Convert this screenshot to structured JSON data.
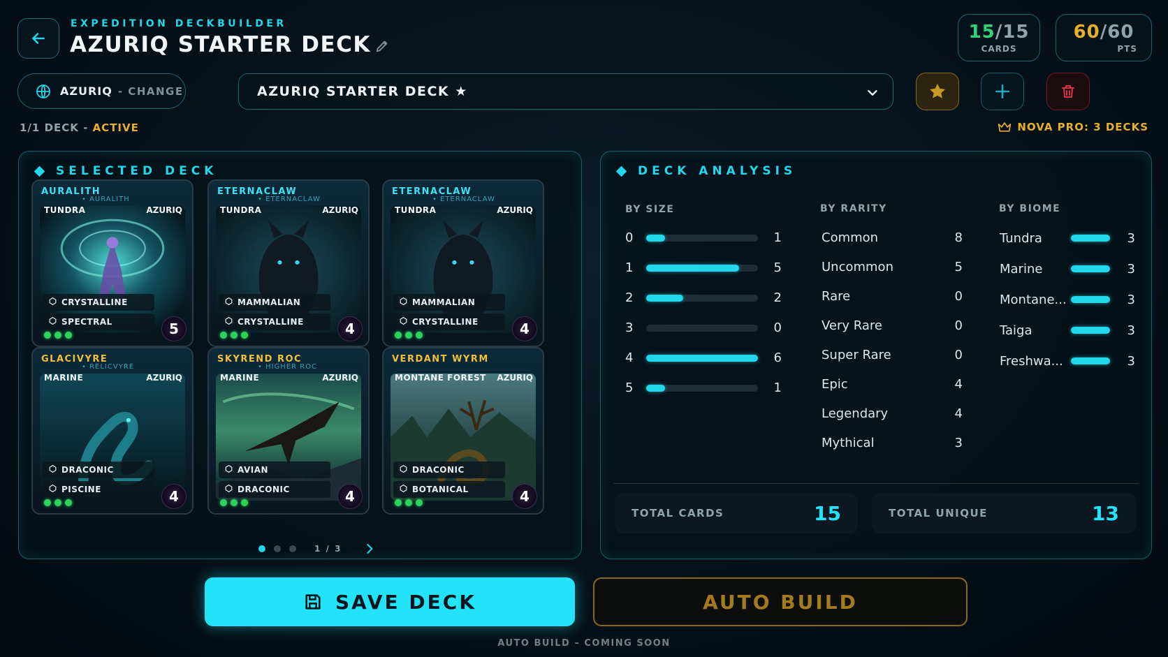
{
  "header": {
    "eyebrow": "EXPEDITION DECKBUILDER",
    "title": "AZURIQ STARTER DECK",
    "cards_count": "15",
    "cards_total": "15",
    "cards_label": "CARDS",
    "pts_count": "60",
    "pts_total": "60",
    "pts_label": "PTS"
  },
  "faction": {
    "name": "AZURIQ",
    "change": "- CHANGE"
  },
  "deck_select": {
    "value": "AZURIQ STARTER DECK ★"
  },
  "deck_status": {
    "count": "1/1 DECK",
    "sep": " - ",
    "state": "ACTIVE"
  },
  "nova_pro": "NOVA PRO: 3 DECKS",
  "selected_deck": {
    "title": "SELECTED DECK",
    "cards": [
      {
        "name": "AURALITH",
        "sub": "• AURALITH",
        "biome": "TUNDRA",
        "faction": "AZURIQ",
        "traits": [
          "CRYSTALLINE",
          "SPECTRAL"
        ],
        "cost": "5",
        "gold": false,
        "art": "aurora"
      },
      {
        "name": "ETERNACLAW",
        "sub": "• ETERNACLAW",
        "biome": "TUNDRA",
        "faction": "AZURIQ",
        "traits": [
          "MAMMALIAN",
          "CRYSTALLINE"
        ],
        "cost": "4",
        "gold": false,
        "art": "wolf"
      },
      {
        "name": "ETERNACLAW",
        "sub": "• ETERNACLAW",
        "biome": "TUNDRA",
        "faction": "AZURIQ",
        "traits": [
          "MAMMALIAN",
          "CRYSTALLINE"
        ],
        "cost": "4",
        "gold": false,
        "art": "wolf"
      },
      {
        "name": "GLACIVYRE",
        "sub": "• RELICVYRE",
        "biome": "MARINE",
        "faction": "AZURIQ",
        "traits": [
          "DRACONIC",
          "PISCINE"
        ],
        "cost": "4",
        "gold": true,
        "art": "sea"
      },
      {
        "name": "SKYREND ROC",
        "sub": "• HIGHER ROC",
        "biome": "MARINE",
        "faction": "AZURIQ",
        "traits": [
          "AVIAN",
          "DRACONIC"
        ],
        "cost": "4",
        "gold": true,
        "art": "bird"
      },
      {
        "name": "VERDANT WYRM",
        "sub": "",
        "biome": "MONTANE FOREST",
        "faction": "AZURIQ",
        "traits": [
          "DRACONIC",
          "BOTANICAL"
        ],
        "cost": "4",
        "gold": true,
        "art": "forest"
      }
    ],
    "page": "1 / 3"
  },
  "analysis": {
    "title": "DECK ANALYSIS",
    "by_size": {
      "label": "BY SIZE",
      "rows": [
        {
          "k": "0",
          "v": "1",
          "frac": 0.167
        },
        {
          "k": "1",
          "v": "5",
          "frac": 0.833
        },
        {
          "k": "2",
          "v": "2",
          "frac": 0.333
        },
        {
          "k": "3",
          "v": "0",
          "frac": 0
        },
        {
          "k": "4",
          "v": "6",
          "frac": 1.0
        },
        {
          "k": "5",
          "v": "1",
          "frac": 0.167
        }
      ]
    },
    "by_rarity": {
      "label": "BY RARITY",
      "rows": [
        {
          "k": "Common",
          "v": "8"
        },
        {
          "k": "Uncommon",
          "v": "5"
        },
        {
          "k": "Rare",
          "v": "0"
        },
        {
          "k": "Very Rare",
          "v": "0"
        },
        {
          "k": "Super Rare",
          "v": "0"
        },
        {
          "k": "Epic",
          "v": "4"
        },
        {
          "k": "Legendary",
          "v": "4"
        },
        {
          "k": "Mythical",
          "v": "3"
        }
      ]
    },
    "by_biome": {
      "label": "BY BIOME",
      "rows": [
        {
          "k": "Tundra",
          "v": "3"
        },
        {
          "k": "Marine",
          "v": "3"
        },
        {
          "k": "Montane...",
          "v": "3"
        },
        {
          "k": "Taiga",
          "v": "3"
        },
        {
          "k": "Freshwa...",
          "v": "3"
        }
      ]
    },
    "total_cards_label": "TOTAL CARDS",
    "total_cards": "15",
    "total_unique_label": "TOTAL UNIQUE",
    "total_unique": "13"
  },
  "actions": {
    "save": "SAVE DECK",
    "auto": "AUTO BUILD",
    "note": "AUTO BUILD – COMING SOON"
  }
}
